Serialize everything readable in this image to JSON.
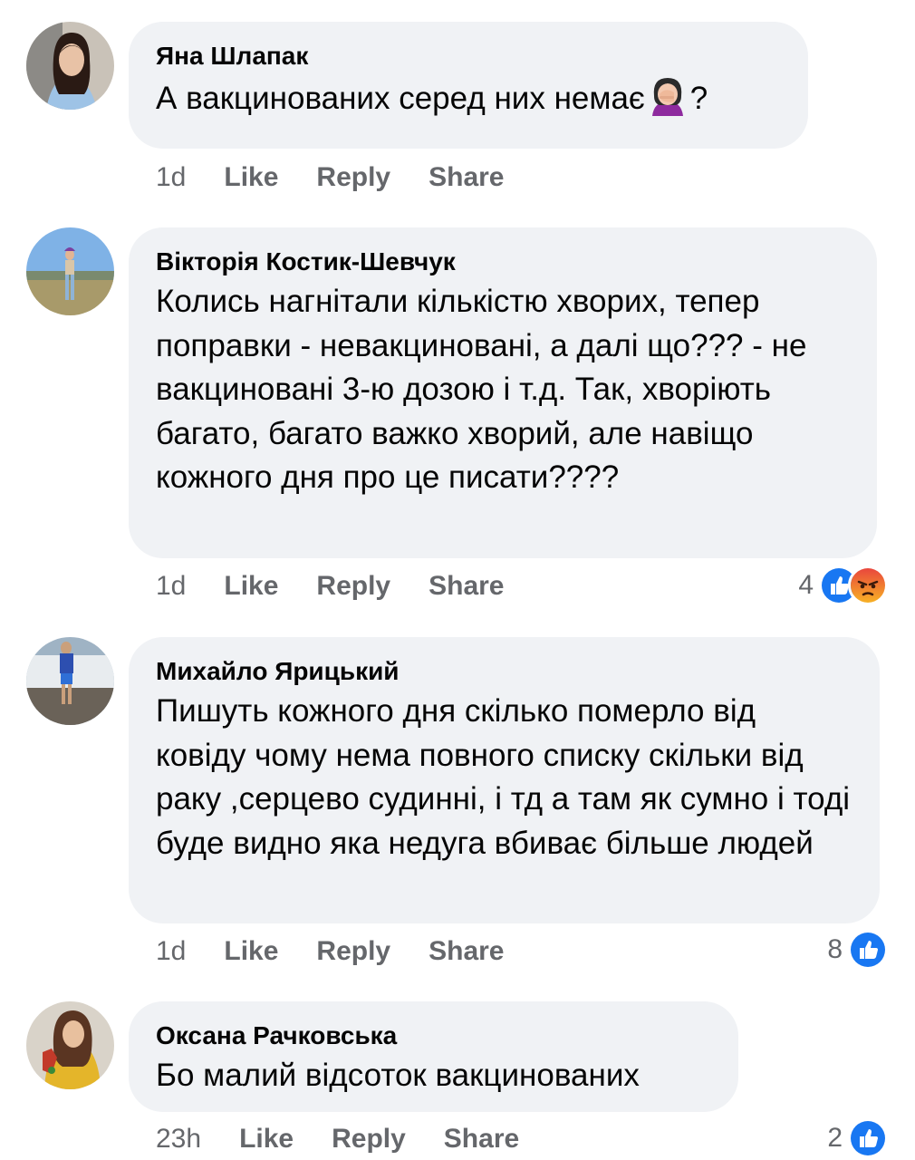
{
  "comments": [
    {
      "author": "Яна Шлапак",
      "text_before": "А вакцинованих серед них немає",
      "emoji": "woman-facepalming",
      "text_after": "?",
      "time": "1d",
      "like": "Like",
      "reply": "Reply",
      "share": "Share"
    },
    {
      "author": "Вікторія Костик-Шевчук",
      "text": "Колись нагнітали кількістю хворих, тепер поправки - невакциновані, а далі що??? - не вакциновані 3-ю дозою і т.д. Так, хворіють багато, багато важко хворий, але навіщо кожного дня про це писати????",
      "time": "1d",
      "like": "Like",
      "reply": "Reply",
      "share": "Share",
      "reaction_count": "4",
      "reactions": [
        "like-reaction",
        "angry-reaction"
      ]
    },
    {
      "author": "Михайло Ярицький",
      "text": "Пишуть кожного дня скілько померло від ковіду чому нема повного списку скільки від раку ,серцево судинні, і тд  а там як сумно і тоді буде видно яка недуга вбиває більше людей",
      "time": "1d",
      "like": "Like",
      "reply": "Reply",
      "share": "Share",
      "reaction_count": "8",
      "reactions": [
        "like-reaction"
      ]
    },
    {
      "author": "Оксана Рачковська",
      "text": "Бо малий відсоток вакцинованих",
      "time": "23h",
      "like": "Like",
      "reply": "Reply",
      "share": "Share",
      "reaction_count": "2",
      "reactions": [
        "like-reaction"
      ]
    }
  ],
  "colors": {
    "bubble": "#f0f2f5",
    "meta_text": "#65676b",
    "like_blue": "#1877f2",
    "angry_orange": "#f0582a"
  }
}
